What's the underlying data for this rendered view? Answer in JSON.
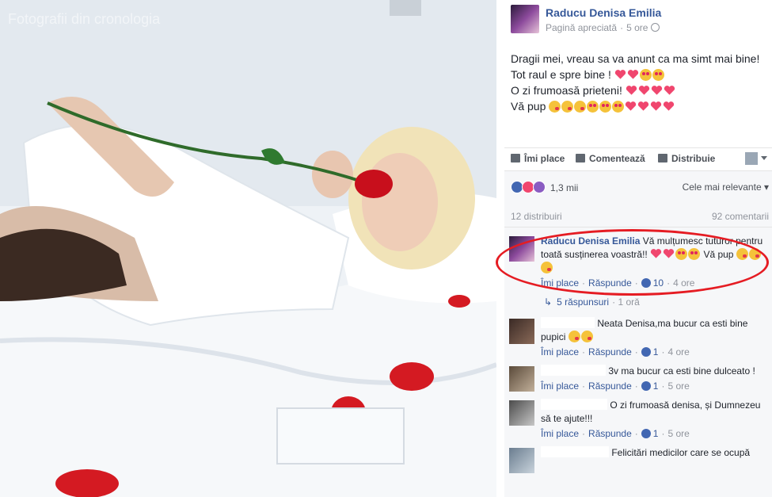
{
  "photo": {
    "caption": "Fotografii din cronologia"
  },
  "post": {
    "author": "Raducu Denisa Emilia",
    "page_type": "Pagină apreciată",
    "time": "5 ore",
    "lines": [
      "Dragii mei, vreau sa va anunt ca ma simt mai bine!",
      "Tot raul e spre bine !",
      "O zi frumoasă prieteni!",
      "Vă pup"
    ]
  },
  "actions": {
    "like": "Îmi place",
    "comment": "Comentează",
    "share": "Distribuie"
  },
  "reactions": {
    "count": "1,3 mii",
    "sort": "Cele mai relevante",
    "shares": "12 distribuiri",
    "comments": "92 comentarii"
  },
  "comments": [
    {
      "name": "Raducu Denisa Emilia",
      "text": "Vă mulțumesc tuturor pentru toată susținerea voastră!!",
      "text_tail": "Vă pup",
      "like": "Îmi place",
      "reply": "Răspunde",
      "likes": "10",
      "time": "4 ore",
      "replies": "5 răspunsuri",
      "replies_time": "1 oră"
    },
    {
      "text": "Neata Denisa,ma bucur ca esti bine pupici",
      "like": "Îmi place",
      "reply": "Răspunde",
      "likes": "1",
      "time": "4 ore"
    },
    {
      "text": "3v ma bucur ca esti bine dulceato !",
      "like": "Îmi place",
      "reply": "Răspunde",
      "likes": "1",
      "time": "5 ore"
    },
    {
      "text": "O zi frumoasă denisa, și Dumnezeu să te ajute!!!",
      "like": "Îmi place",
      "reply": "Răspunde",
      "likes": "1",
      "time": "5 ore"
    },
    {
      "text": "Felicitări medicilor care se ocupă"
    }
  ],
  "colors": {
    "link": "#365899",
    "highlight_ellipse": "#e51c23",
    "muted": "#90949c"
  }
}
